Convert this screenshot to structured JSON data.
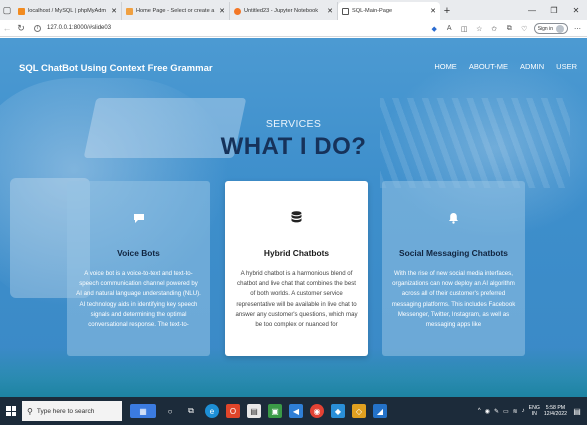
{
  "browser": {
    "tabs": [
      {
        "title": "localhost / MySQL | phpMyAdm",
        "icon": "phpmyadmin-icon",
        "color": "#f28b20"
      },
      {
        "title": "Home Page - Select or create a",
        "icon": "page-icon",
        "color": "#f0a040"
      },
      {
        "title": "Untitled23 - Jupyter Notebook",
        "icon": "jupyter-icon",
        "color": "#f37726"
      },
      {
        "title": "SQL-Main-Page",
        "icon": "document-icon",
        "color": "#555555",
        "active": true
      }
    ],
    "url": "127.0.0.1:8000/#slide03",
    "signin_label": "Sign in"
  },
  "site": {
    "brand": "SQL ChatBot Using Context Free Grammar",
    "menu": [
      "HOME",
      "ABOUT-ME",
      "ADMIN",
      "USER"
    ],
    "eyebrow": "SERVICES",
    "headline": "WHAT I DO?"
  },
  "cards": [
    {
      "title": "Voice Bots",
      "icon": "chat-bubble-icon",
      "body": "A voice bot is a voice-to-text and text-to-speech communication channel powered by AI and natural language understanding (NLU). AI technology aids in identifying key speech signals and determining the optimal conversational response. The text-to-"
    },
    {
      "title": "Hybrid Chatbots",
      "icon": "database-icon",
      "body": "A hybrid chatbot is a harmonious blend of chatbot and live chat that combines the best of both worlds. A customer service representative will be available in live chat to answer any customer's questions, which may be too complex or nuanced for"
    },
    {
      "title": "Social Messaging Chatbots",
      "icon": "bell-icon",
      "body": "With the rise of new social media interfaces, organizations can now deploy an AI algorithm across all of their customer's preferred messaging platforms. This includes Facebook Messenger, Twitter, Instagram, as well as messaging apps like"
    }
  ],
  "taskbar": {
    "search_placeholder": "Type here to search",
    "lang_top": "ENG",
    "lang_bottom": "IN",
    "time": "5:58 PM",
    "date": "12/4/2022"
  },
  "colors": {
    "page_blue": "#3e8fcc",
    "headline": "#16325a",
    "taskbar": "#1c2b3a"
  }
}
